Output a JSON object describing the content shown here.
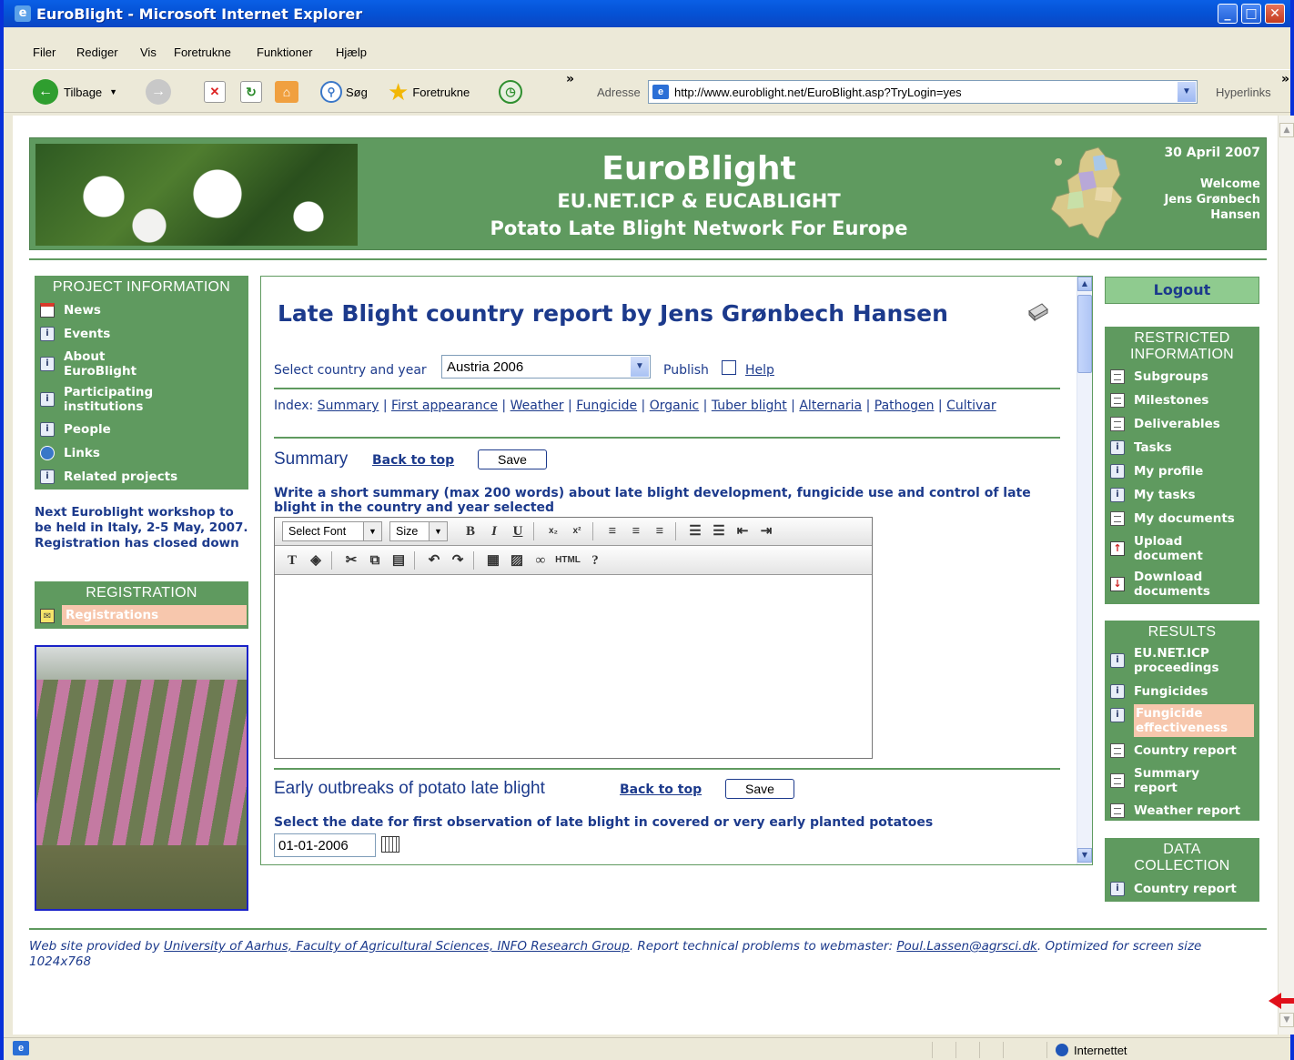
{
  "window": {
    "title": "EuroBlight - Microsoft Internet Explorer"
  },
  "menu": [
    "Filer",
    "Rediger",
    "Vis",
    "Foretrukne",
    "Funktioner",
    "Hjælp"
  ],
  "toolbar": {
    "back_label": "Tilbage",
    "search_label": "Søg",
    "favorites_label": "Foretrukne",
    "address_label": "Adresse",
    "address_value": "http://www.euroblight.net/EuroBlight.asp?TryLogin=yes",
    "links_label": "Hyperlinks"
  },
  "status": {
    "zone": "Internettet"
  },
  "header": {
    "title": "EuroBlight",
    "subtitle1": "EU.NET.ICP & EUCABLIGHT",
    "subtitle2": "Potato Late Blight Network For Europe",
    "date": "30 April 2007",
    "welcome": "Welcome",
    "user": "Jens Grønbech Hansen"
  },
  "left": {
    "project_head": "PROJECT INFORMATION",
    "project_items": [
      {
        "label": "News",
        "icon": "news-icon"
      },
      {
        "label": "Events",
        "icon": "info-icon"
      },
      {
        "label": "About EuroBlight",
        "icon": "info-icon"
      },
      {
        "label": "Participating institutions",
        "icon": "info-icon"
      },
      {
        "label": "People",
        "icon": "info-icon"
      },
      {
        "label": "Links",
        "icon": "links-icon"
      },
      {
        "label": "Related projects",
        "icon": "info-icon"
      }
    ],
    "notice": "Next Euroblight workshop to be held in Italy, 2-5 May, 2007. Registration has closed down",
    "registration_head": "REGISTRATION",
    "registration_item": "Registrations"
  },
  "main": {
    "title": "Late Blight country report by Jens Grønbech Hansen",
    "select_label": "Select country and year",
    "country_year": "Austria 2006",
    "publish_label": "Publish",
    "help_label": "Help",
    "index_label": "Index:",
    "index_links": [
      "Summary",
      "First appearance",
      "Weather",
      "Fungicide",
      "Organic",
      "Tuber blight",
      "Alternaria",
      "Pathogen",
      "Cultivar"
    ],
    "summary_title": "Summary",
    "back_to_top": "Back to top",
    "save_label": "Save",
    "summary_hint": "Write a short summary (max 200 words) about late blight development, fungicide use and control of late blight in the country and year selected",
    "editor": {
      "font_label": "Select Font",
      "size_label": "Size",
      "html_label": "HTML"
    },
    "early_title": "Early outbreaks of potato late blight",
    "early_hint": "Select the date for first observation of late blight in covered or very early planted potatoes",
    "early_date": "01-01-2006"
  },
  "right": {
    "logout": "Logout",
    "restricted_head": "RESTRICTED INFORMATION",
    "restricted_items": [
      {
        "label": "Subgroups",
        "icon": "doc-icon"
      },
      {
        "label": "Milestones",
        "icon": "doc-icon"
      },
      {
        "label": "Deliverables",
        "icon": "doc-icon"
      },
      {
        "label": "Tasks",
        "icon": "info-icon"
      },
      {
        "label": "My profile",
        "icon": "info-icon"
      },
      {
        "label": "My tasks",
        "icon": "info-icon"
      },
      {
        "label": "My documents",
        "icon": "doc-icon"
      },
      {
        "label": "Upload document",
        "icon": "upload-icon"
      },
      {
        "label": "Download documents",
        "icon": "download-icon"
      }
    ],
    "results_head": "RESULTS",
    "results_items": [
      {
        "label": "EU.NET.ICP proceedings",
        "icon": "info-icon"
      },
      {
        "label": "Fungicides",
        "icon": "info-icon"
      },
      {
        "label": "Fungicide effectiveness",
        "icon": "info-icon"
      },
      {
        "label": "Country report",
        "icon": "doc-icon"
      },
      {
        "label": "Summary report",
        "icon": "doc-icon"
      },
      {
        "label": "Weather report",
        "icon": "doc-icon"
      }
    ],
    "data_head": "DATA COLLECTION",
    "data_items": [
      {
        "label": "Country report",
        "icon": "info-icon"
      }
    ]
  },
  "footer": {
    "prefix": "Web site provided by ",
    "provider_link": "University of Aarhus, Faculty of Agricultural Sciences, INFO Research Group",
    "mid": ". Report technical problems to webmaster: ",
    "email_link": "Poul.Lassen@agrsci.dk",
    "suffix": ". Optimized for screen size 1024x768"
  },
  "colors": {
    "panel_green": "#5f9a5f",
    "link_blue": "#1c3a8c",
    "highlight": "#f7c7ad"
  }
}
